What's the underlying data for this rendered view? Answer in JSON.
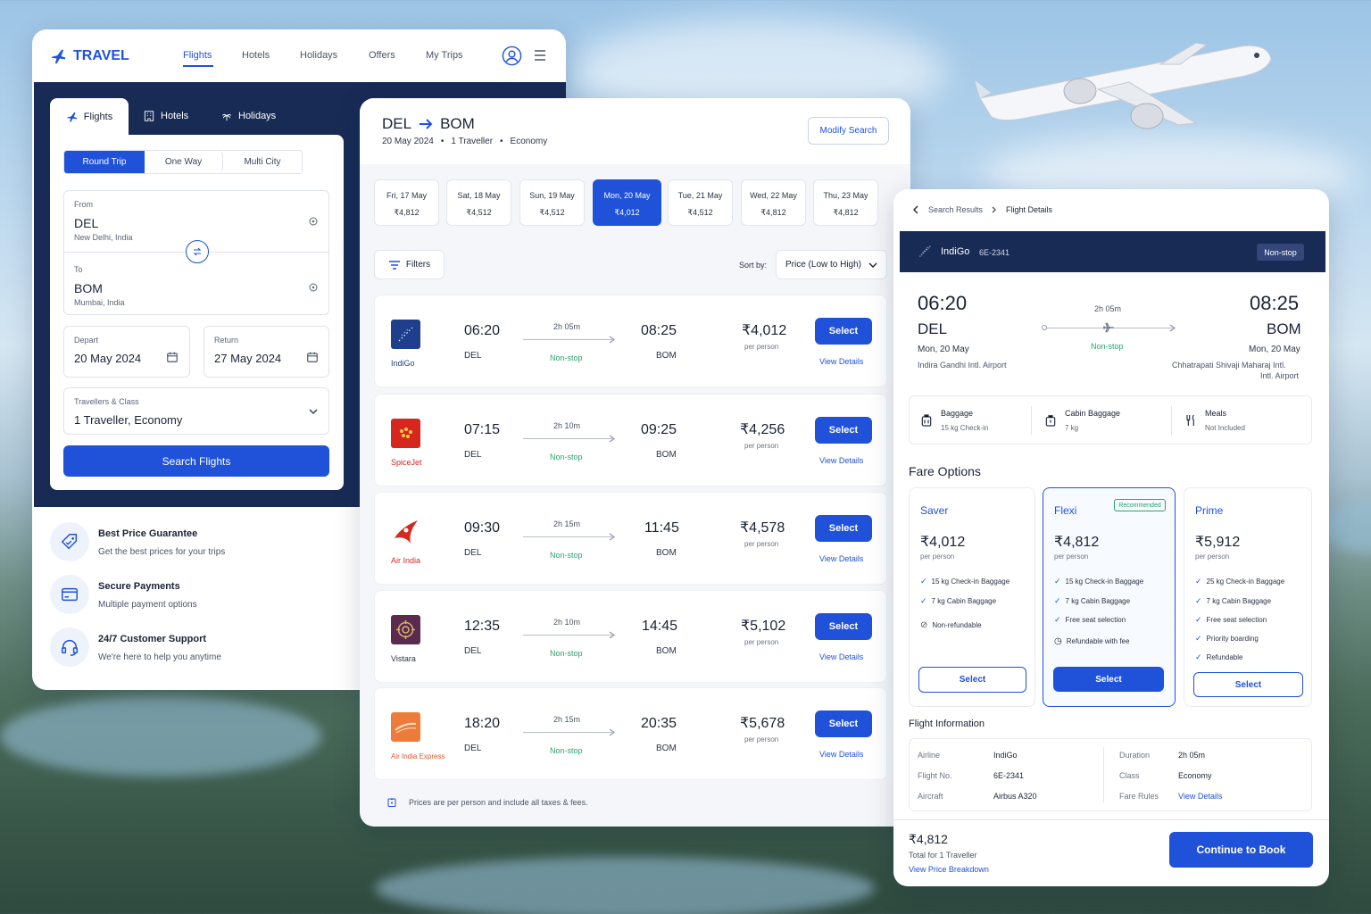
{
  "left": {
    "brand": "TRAVEL",
    "nav": [
      "Flights",
      "Hotels",
      "Holidays",
      "Offers",
      "My Trips"
    ],
    "tabs": [
      "Flights",
      "Hotels",
      "Holidays"
    ],
    "trip_types": [
      "Round Trip",
      "One Way",
      "Multi City"
    ],
    "from_label": "From",
    "from_code": "DEL",
    "from_city": "New Delhi, India",
    "to_label": "To",
    "to_code": "BOM",
    "to_city": "Mumbai, India",
    "depart_label": "Depart",
    "depart_value": "20 May 2024",
    "return_label": "Return",
    "return_value": "27 May 2024",
    "travellers_label": "Travellers & Class",
    "travellers_value": "1 Traveller, Economy",
    "search_button": "Search Flights",
    "features": [
      {
        "title": "Best Price Guarantee",
        "desc": "Get the best prices for your trips"
      },
      {
        "title": "Secure Payments",
        "desc": "Multiple payment options"
      },
      {
        "title": "24/7 Customer Support",
        "desc": "We're here to help you anytime"
      }
    ]
  },
  "results": {
    "from": "DEL",
    "to": "BOM",
    "date": "20 May 2024",
    "travellers": "1 Traveller",
    "class": "Economy",
    "modify": "Modify Search",
    "dates": [
      {
        "day": "Fri, 17 May",
        "price": "₹4,812"
      },
      {
        "day": "Sat, 18 May",
        "price": "₹4,512"
      },
      {
        "day": "Sun, 19 May",
        "price": "₹4,512"
      },
      {
        "day": "Mon, 20 May",
        "price": "₹4,012"
      },
      {
        "day": "Tue, 21 May",
        "price": "₹4,512"
      },
      {
        "day": "Wed, 22 May",
        "price": "₹4,812"
      },
      {
        "day": "Thu, 23 May",
        "price": "₹4,812"
      }
    ],
    "filters": "Filters",
    "sort_label": "Sort by:",
    "sort_value": "Price (Low to High)",
    "flights": [
      {
        "airline": "IndiGo",
        "dep": "06:20",
        "arr": "08:25",
        "from": "DEL",
        "to": "BOM",
        "duration": "2h 05m",
        "stops": "Non-stop",
        "price": "₹4,012",
        "per": "per person",
        "select": "Select",
        "details": "View Details",
        "color": "#1f3f8c"
      },
      {
        "airline": "SpiceJet",
        "dep": "07:15",
        "arr": "09:25",
        "from": "DEL",
        "to": "BOM",
        "duration": "2h 10m",
        "stops": "Non-stop",
        "price": "₹4,256",
        "per": "per person",
        "select": "Select",
        "details": "View Details",
        "color": "#d6261d"
      },
      {
        "airline": "Air India",
        "dep": "09:30",
        "arr": "11:45",
        "from": "DEL",
        "to": "BOM",
        "duration": "2h 15m",
        "stops": "Non-stop",
        "price": "₹4,578",
        "per": "per person",
        "select": "Select",
        "details": "View Details",
        "color": "#d42a21"
      },
      {
        "airline": "Vistara",
        "dep": "12:35",
        "arr": "14:45",
        "from": "DEL",
        "to": "BOM",
        "duration": "2h 10m",
        "stops": "Non-stop",
        "price": "₹5,102",
        "per": "per person",
        "select": "Select",
        "details": "View Details",
        "color": "#5a2a4f"
      },
      {
        "airline": "Air India Express",
        "dep": "18:20",
        "arr": "20:35",
        "from": "DEL",
        "to": "BOM",
        "duration": "2h 15m",
        "stops": "Non-stop",
        "price": "₹5,678",
        "per": "per person",
        "select": "Select",
        "details": "View Details",
        "color": "#ef7b3a"
      }
    ],
    "note": "Prices are per person and include all taxes & fees."
  },
  "details": {
    "crumb1": "Search Results",
    "crumb2": "Flight Details",
    "airline": "IndiGo",
    "flight_no": "6E-2341",
    "badge": "Non-stop",
    "dep": "06:20",
    "arr": "08:25",
    "from": "DEL",
    "to": "BOM",
    "dep_date": "Mon, 20 May",
    "arr_date": "Mon, 20 May",
    "dep_airport": "Indira Gandhi Intl. Airport",
    "arr_airport_1": "Chhatrapati Shivaji Maharaj Intl.",
    "arr_airport_2": "Intl. Airport",
    "duration": "2h 05m",
    "stops": "Non-stop",
    "baggage": {
      "label": "Baggage",
      "value": "15 kg Check-in"
    },
    "cabin": {
      "label": "Cabin Baggage",
      "value": "7 kg"
    },
    "meals": {
      "label": "Meals",
      "value": "Not Included"
    },
    "fare_title": "Fare Options",
    "fares": [
      {
        "name": "Saver",
        "price": "₹4,012",
        "per": "per person",
        "features": [
          "15 kg Check-in Baggage",
          "7 kg Cabin Baggage",
          "Non-refundable"
        ],
        "button": "Select"
      },
      {
        "name": "Flexi",
        "price": "₹4,812",
        "per": "per person",
        "badge": "Recommended",
        "features": [
          "15 kg Check-in Baggage",
          "7 kg Cabin Baggage",
          "Free seat selection",
          "Refundable with fee"
        ],
        "button": "Select"
      },
      {
        "name": "Prime",
        "price": "₹5,912",
        "per": "per person",
        "features": [
          "25 kg Check-in Baggage",
          "7 kg Cabin Baggage",
          "Free seat selection",
          "Priority boarding",
          "Refundable"
        ],
        "button": "Select"
      }
    ],
    "info_title": "Flight Information",
    "info": {
      "airline_l": "Airline",
      "airline_v": "IndiGo",
      "flight_l": "Flight No.",
      "flight_v": "6E-2341",
      "aircraft_l": "Aircraft",
      "aircraft_v": "Airbus A320",
      "duration_l": "Duration",
      "duration_v": "2h 05m",
      "class_l": "Class",
      "class_v": "Economy",
      "rules_l": "Fare Rules",
      "rules_v": "View Details"
    },
    "total_price": "₹4,812",
    "total_label": "Total for 1 Traveller",
    "breakdown": "View Price Breakdown",
    "continue": "Continue to Book"
  }
}
